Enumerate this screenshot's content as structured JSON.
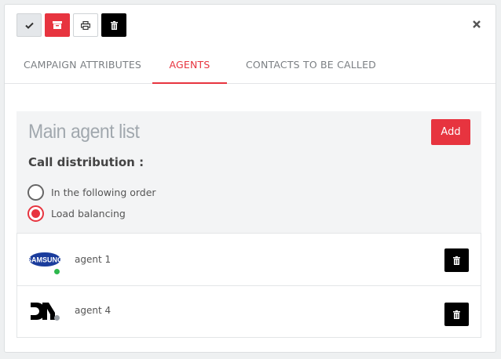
{
  "toolbar": {
    "buttons": [
      {
        "icon": "check-icon"
      },
      {
        "icon": "archive-icon"
      },
      {
        "icon": "print-icon"
      },
      {
        "icon": "trash-icon"
      }
    ]
  },
  "tabs": [
    {
      "label": "CAMPAIGN ATTRIBUTES",
      "active": false
    },
    {
      "label": "AGENTS",
      "active": true
    },
    {
      "label": "CONTACTS TO BE CALLED",
      "active": false
    }
  ],
  "section": {
    "title": "Main agent list",
    "add_label": "Add",
    "distribution_label": "Call distribution :",
    "options": [
      {
        "label": "In the following order",
        "selected": false
      },
      {
        "label": "Load balancing",
        "selected": true
      }
    ]
  },
  "agents": [
    {
      "name": "agent 1",
      "logo": "SAMSUNG",
      "status": "online",
      "status_color": "#2db84d"
    },
    {
      "name": "agent 4",
      "logo": "DN",
      "status": "offline",
      "status_color": "#9aa0a6"
    }
  ],
  "colors": {
    "accent": "#e7343f",
    "muted": "#a1a8ae"
  }
}
